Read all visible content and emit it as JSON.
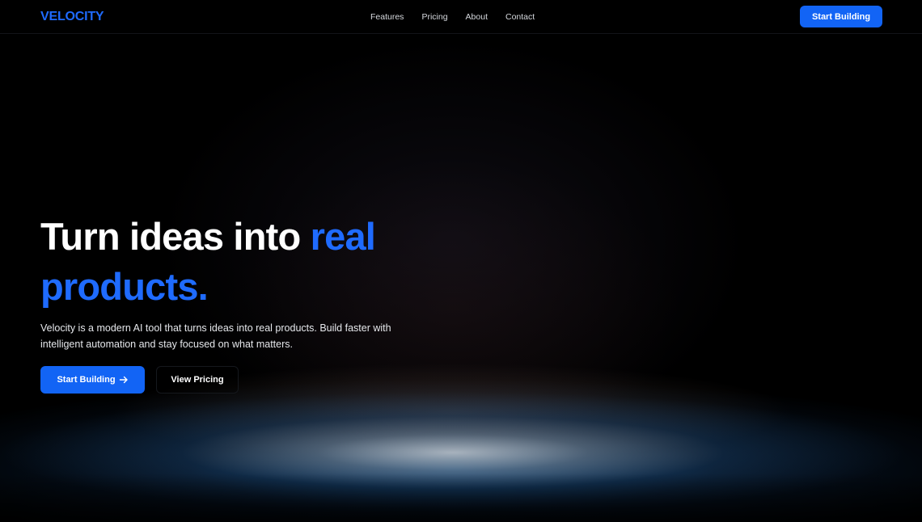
{
  "nav": {
    "logo": "VELOCITY",
    "links": [
      "Features",
      "Pricing",
      "About",
      "Contact"
    ],
    "cta_label": "Start Building"
  },
  "hero": {
    "headline_white": "Turn ideas into ",
    "headline_accent_1": "real",
    "headline_accent_2": "products.",
    "subtext": "Velocity is a modern AI tool that turns ideas into real products. Build faster with intelligent automation and stay focused on what matters.",
    "primary_label": "Start Building",
    "primary_icon": "arrow-right-icon",
    "secondary_label": "View Pricing"
  },
  "colors": {
    "accent": "#1f6bff",
    "button": "#1264f5",
    "background": "#000000"
  }
}
